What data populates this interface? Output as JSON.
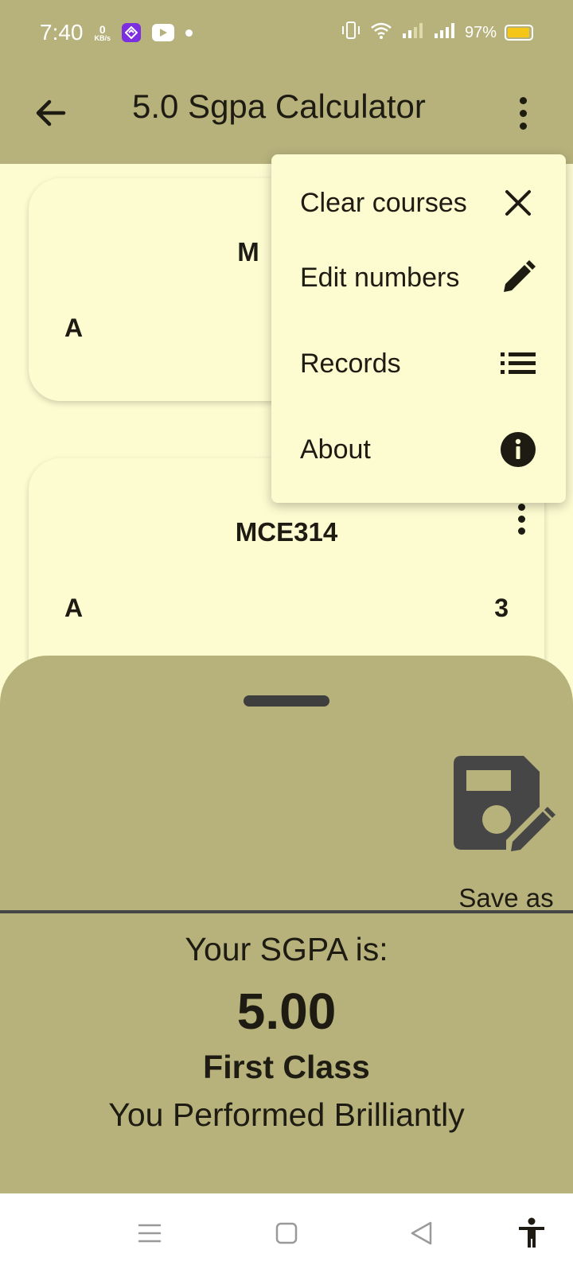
{
  "status_bar": {
    "time": "7:40",
    "net_speed_value": "0",
    "net_speed_unit": "KB/s",
    "battery_percent": "97%",
    "battery_level": 0.97,
    "icons": [
      "app-notification-icon",
      "youtube-icon",
      "dot-icon",
      "vibrate-icon",
      "wifi-icon",
      "signal-icon",
      "battery-icon"
    ]
  },
  "app_bar": {
    "title": "5.0 Sgpa Calculator",
    "back_icon": "arrow-back-icon",
    "more_icon": "more-vertical-icon"
  },
  "courses": [
    {
      "code_visible": "M",
      "grade": "A",
      "units": ""
    },
    {
      "code": "MCE314",
      "grade": "A",
      "units": "3"
    }
  ],
  "menu": {
    "items": [
      {
        "label": "Clear courses",
        "icon": "close-icon"
      },
      {
        "label": "Edit numbers",
        "icon": "pencil-icon"
      },
      {
        "label": "Records",
        "icon": "list-icon"
      },
      {
        "label": "About",
        "icon": "info-icon"
      }
    ]
  },
  "sheet": {
    "save_label": "Save as",
    "sgpa_label": "Your SGPA is:",
    "sgpa_value": "5.00",
    "class_label": "First Class",
    "remark": "You Performed Brilliantly"
  },
  "colors": {
    "app_bar": "#B7B27C",
    "surface": "#FDFBD0",
    "text": "#1d1b12",
    "battery": "#F5C518"
  },
  "nav_bar": {
    "icons": [
      "recent-apps-icon",
      "home-icon",
      "back-triangle-icon",
      "accessibility-icon"
    ]
  }
}
